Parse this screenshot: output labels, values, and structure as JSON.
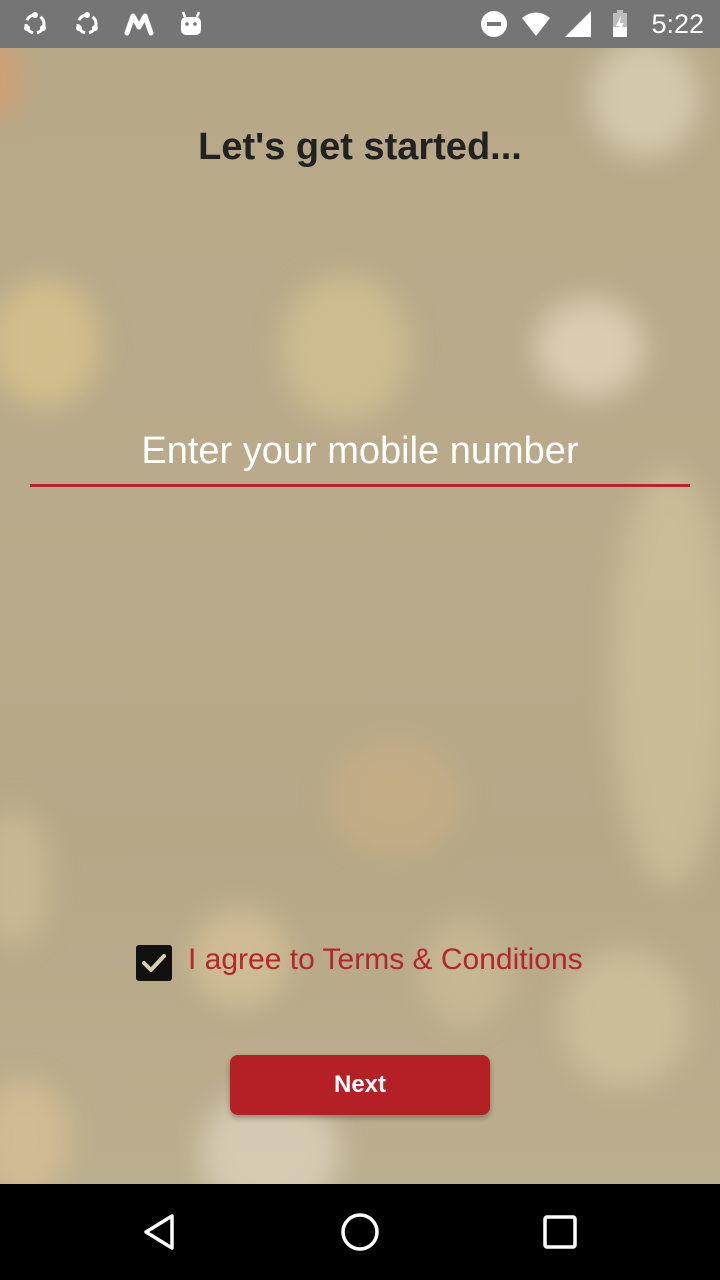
{
  "status_bar": {
    "time": "5:22",
    "left_icons": [
      "sync-icon",
      "sync-icon",
      "m-app-icon",
      "android-icon"
    ],
    "right_icons": [
      "do-not-disturb-icon",
      "wifi-icon",
      "signal-icon",
      "battery-charging-icon"
    ]
  },
  "page": {
    "title": "Let's get started..."
  },
  "mobile_input": {
    "placeholder": "Enter your mobile number",
    "value": ""
  },
  "terms": {
    "checked": true,
    "label": "I agree to Terms & Conditions"
  },
  "actions": {
    "next_label": "Next"
  },
  "navigation": {
    "buttons": [
      "back-icon",
      "home-icon",
      "recents-icon"
    ]
  },
  "colors": {
    "accent": "#b3262b",
    "button": "#b51f26",
    "status_bar": "#757575",
    "background": "#b8a98a",
    "title_text": "#222222"
  }
}
